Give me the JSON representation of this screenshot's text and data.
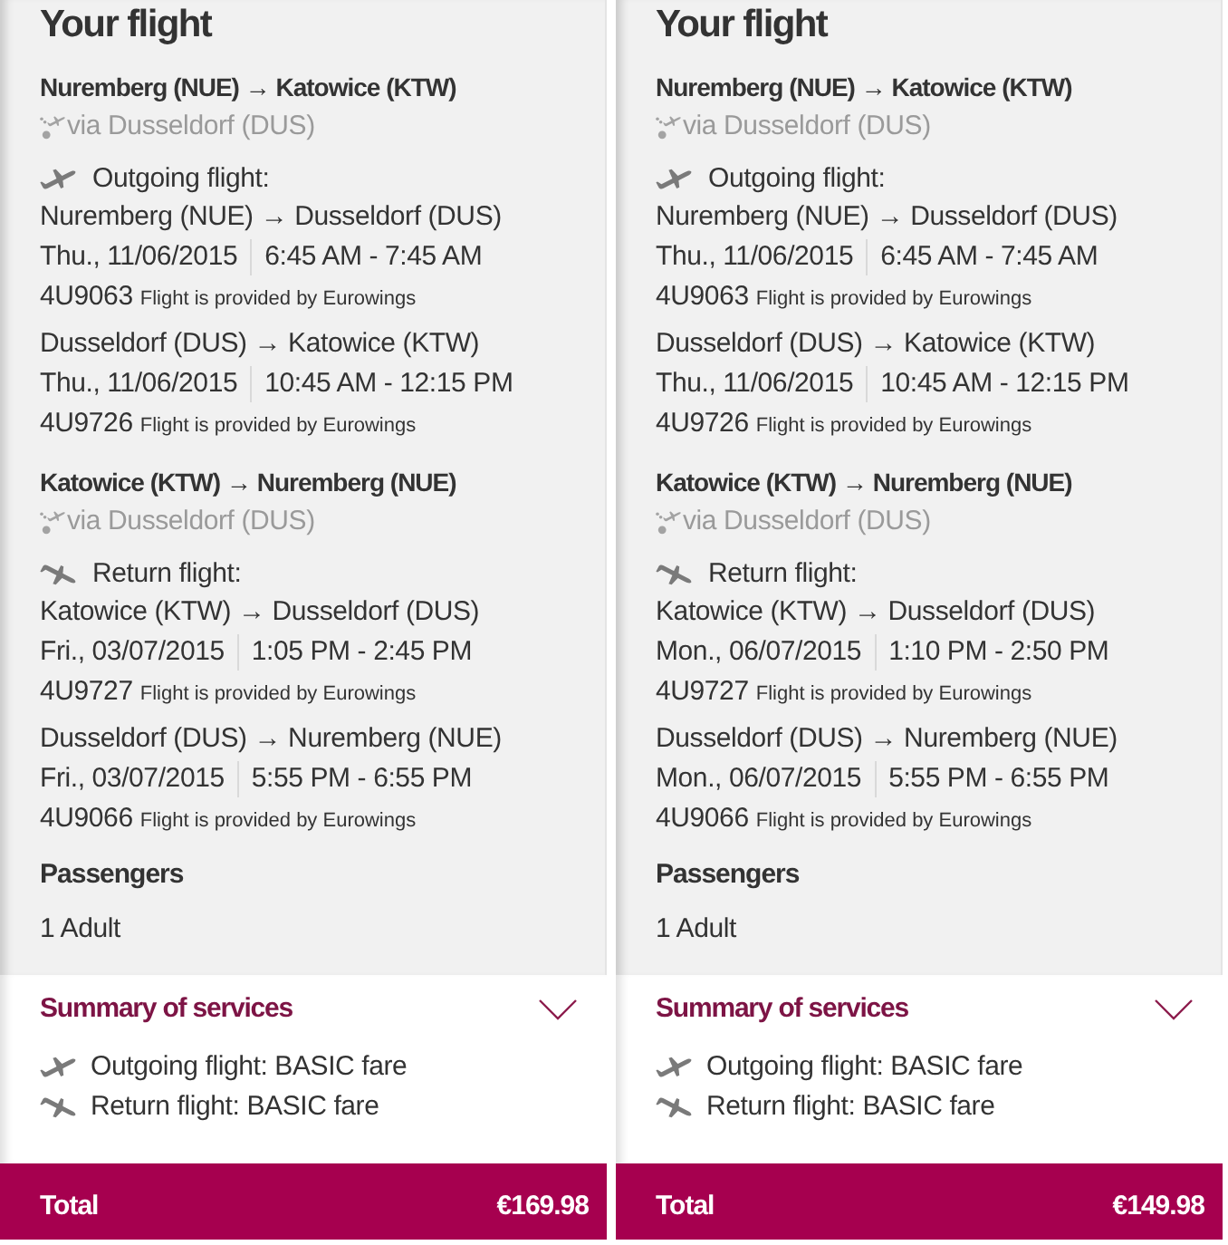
{
  "panels": [
    {
      "title": "Your flight",
      "journeys": [
        {
          "kind": "outgoing",
          "route": "Nuremberg (NUE) → Katowice (KTW)",
          "via": "via Dusseldorf (DUS)",
          "label": "Outgoing flight:",
          "segments": [
            {
              "route": "Nuremberg (NUE) → Dusseldorf (DUS)",
              "date": "Thu., 11/06/2015",
              "time": "6:45 AM - 7:45 AM",
              "flight_number": "4U9063",
              "operator": "Flight is provided by Eurowings"
            },
            {
              "route": "Dusseldorf (DUS) → Katowice (KTW)",
              "date": "Thu., 11/06/2015",
              "time": "10:45 AM - 12:15 PM",
              "flight_number": "4U9726",
              "operator": "Flight is provided by Eurowings"
            }
          ]
        },
        {
          "kind": "return",
          "route": "Katowice (KTW) → Nuremberg (NUE)",
          "via": "via Dusseldorf (DUS)",
          "label": "Return flight:",
          "segments": [
            {
              "route": "Katowice (KTW) → Dusseldorf (DUS)",
              "date": "Fri., 03/07/2015",
              "time": "1:05 PM - 2:45 PM",
              "flight_number": "4U9727",
              "operator": "Flight is provided by Eurowings"
            },
            {
              "route": "Dusseldorf (DUS) → Nuremberg (NUE)",
              "date": "Fri., 03/07/2015",
              "time": "5:55 PM - 6:55 PM",
              "flight_number": "4U9066",
              "operator": "Flight is provided by Eurowings"
            }
          ]
        }
      ],
      "passengers": {
        "heading": "Passengers",
        "value": "1 Adult"
      },
      "services": {
        "title": "Summary of services",
        "items": [
          {
            "kind": "outgoing",
            "text": "Outgoing flight: BASIC fare"
          },
          {
            "kind": "return",
            "text": "Return flight: BASIC fare"
          }
        ]
      },
      "total": {
        "label": "Total",
        "amount": "€169.98"
      }
    },
    {
      "title": "Your flight",
      "journeys": [
        {
          "kind": "outgoing",
          "route": "Nuremberg (NUE) → Katowice (KTW)",
          "via": "via Dusseldorf (DUS)",
          "label": "Outgoing flight:",
          "segments": [
            {
              "route": "Nuremberg (NUE) → Dusseldorf (DUS)",
              "date": "Thu., 11/06/2015",
              "time": "6:45 AM - 7:45 AM",
              "flight_number": "4U9063",
              "operator": "Flight is provided by Eurowings"
            },
            {
              "route": "Dusseldorf (DUS) → Katowice (KTW)",
              "date": "Thu., 11/06/2015",
              "time": "10:45 AM - 12:15 PM",
              "flight_number": "4U9726",
              "operator": "Flight is provided by Eurowings"
            }
          ]
        },
        {
          "kind": "return",
          "route": "Katowice (KTW) → Nuremberg (NUE)",
          "via": "via Dusseldorf (DUS)",
          "label": "Return flight:",
          "segments": [
            {
              "route": "Katowice (KTW) → Dusseldorf (DUS)",
              "date": "Mon., 06/07/2015",
              "time": "1:10 PM - 2:50 PM",
              "flight_number": "4U9727",
              "operator": "Flight is provided by Eurowings"
            },
            {
              "route": "Dusseldorf (DUS) → Nuremberg (NUE)",
              "date": "Mon., 06/07/2015",
              "time": "5:55 PM - 6:55 PM",
              "flight_number": "4U9066",
              "operator": "Flight is provided by Eurowings"
            }
          ]
        }
      ],
      "passengers": {
        "heading": "Passengers",
        "value": "1 Adult"
      },
      "services": {
        "title": "Summary of services",
        "items": [
          {
            "kind": "outgoing",
            "text": "Outgoing flight: BASIC fare"
          },
          {
            "kind": "return",
            "text": "Return flight: BASIC fare"
          }
        ]
      },
      "total": {
        "label": "Total",
        "amount": "€149.98"
      }
    }
  ]
}
